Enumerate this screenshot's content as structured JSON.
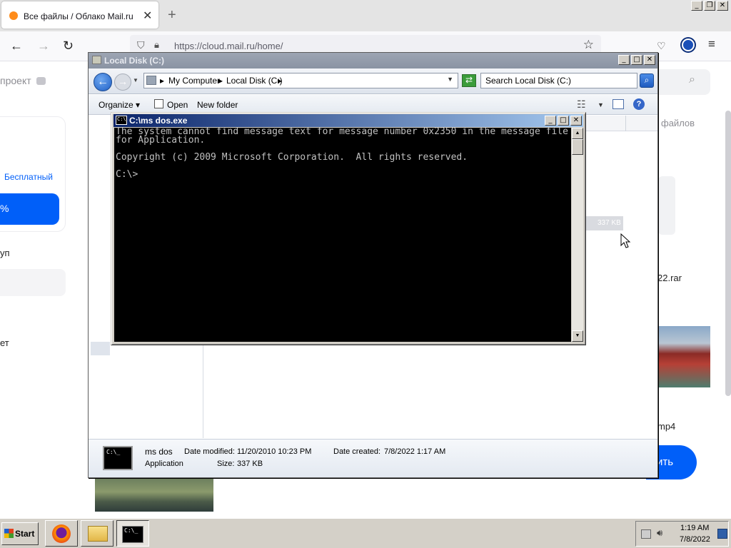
{
  "browser": {
    "tab_title": "Все файлы / Облако Mail.ru",
    "tab_close": "✕",
    "new_tab": "+",
    "url": "https://cloud.mail.ru/home/"
  },
  "webpage": {
    "project_label": "проект",
    "free_plan": "Бесплатный",
    "blue_button_text": "%",
    "group_label": "уп",
    "internet_label": "ет",
    "files_header": "файлов",
    "rar_file": "22.rar",
    "mp4_file": "mp4",
    "upload_button": "ить"
  },
  "explorer": {
    "title": "Local Disk (C:)",
    "breadcrumbs": [
      "My Computer",
      "Local Disk (C:)"
    ],
    "search_placeholder": "Search Local Disk (C:)",
    "toolbar": {
      "organize": "Organize",
      "open": "Open",
      "new_folder": "New folder"
    },
    "selected_size": "337 KB",
    "details": {
      "name": "ms dos",
      "type": "Application",
      "modified_label": "Date modified:",
      "modified_value": "11/20/2010 10:23 PM",
      "created_label": "Date created:",
      "created_value": "7/8/2022 1:17 AM",
      "size_label": "Size:",
      "size_value": "337 KB"
    }
  },
  "console": {
    "title": "C:\\ms dos.exe",
    "output": "The system cannot find message text for message number 0x2350 in the message file for Application.\n\nCopyright (c) 2009 Microsoft Corporation.  All rights reserved.\n\nC:\\>"
  },
  "taskbar": {
    "start_label": "Start",
    "time": "1:19 AM",
    "date": "7/8/2022"
  },
  "colors": {
    "mail_blue": "#005ff9",
    "console_bg": "#000000",
    "console_text": "#c0c0c0"
  }
}
